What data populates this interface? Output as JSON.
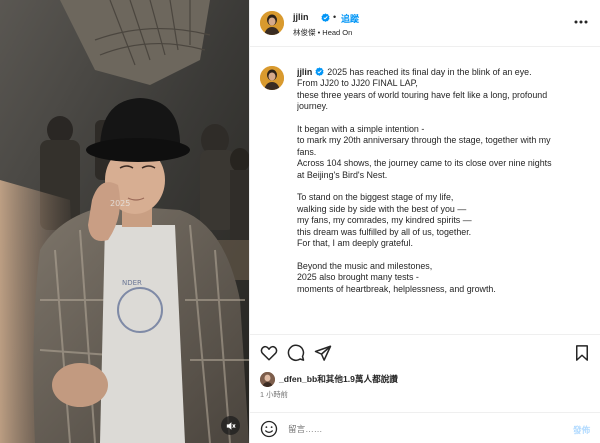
{
  "post": {
    "username": "jjlin",
    "follow_label": "追蹤",
    "separator": "•",
    "subtitle": "林俊傑 • Head On",
    "media_watermark": "2025",
    "caption": {
      "username": "jjlin",
      "paragraphs": [
        [
          "2025 has reached its final day in the blink of an eye.",
          "From JJ20 to JJ20 FINAL LAP,",
          "these three years of world touring have felt like a long, profound",
          "journey."
        ],
        [
          "It began with a simple intention -",
          "to mark my 20th anniversary through the stage, together with my",
          "fans.",
          "Across 104 shows, the journey came to its close over nine nights",
          "at Beijing's Bird's Nest."
        ],
        [
          "To stand on the biggest stage of my life,",
          "walking side by side with the best of you —",
          "my fans, my comrades, my kindred spirits —",
          "this dream was fulfilled by all of us, together.",
          "For that, I am deeply grateful."
        ],
        [
          "Beyond the music and milestones,",
          "2025 also brought many tests -",
          "moments of heartbreak, helplessness, and growth."
        ]
      ]
    },
    "likes_text": "_dfen_bb和其他1.9萬人都說讚",
    "time_ago": "1 小時前",
    "comment": {
      "placeholder": "留言……",
      "post_label": "發佈"
    },
    "colors": {
      "accent": "#0095f6",
      "post_disabled": "#b3dbff",
      "muted": "#737373"
    },
    "icons": [
      "verified-badge-icon",
      "more-options-icon",
      "heart-icon",
      "comment-icon",
      "share-icon",
      "bookmark-icon",
      "emoji-icon",
      "mute-icon"
    ]
  }
}
